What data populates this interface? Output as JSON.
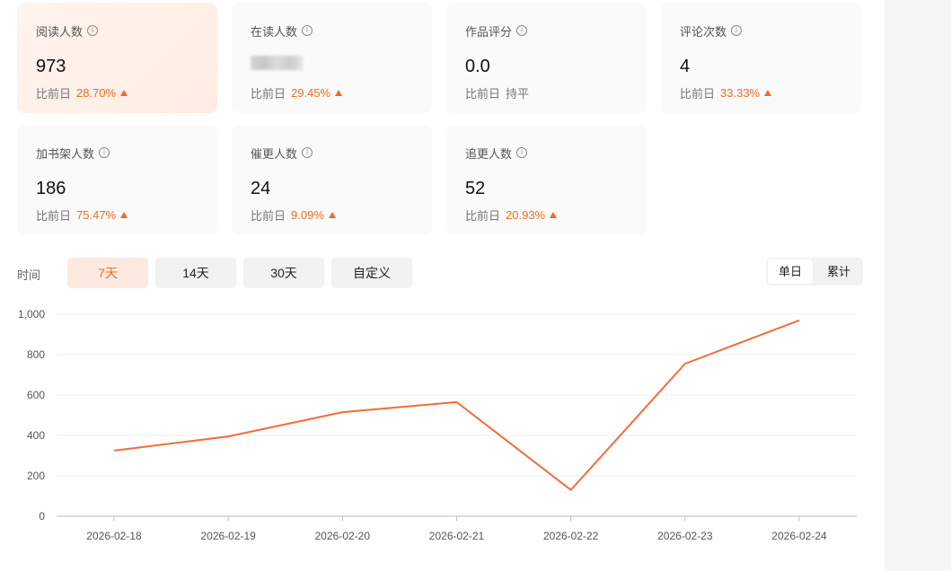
{
  "cards": [
    {
      "title": "阅读人数",
      "value": "973",
      "compare_label": "比前日",
      "compare_value": "28.70%",
      "trend": "up"
    },
    {
      "title": "在读人数",
      "value": "",
      "compare_label": "比前日",
      "compare_value": "29.45%",
      "trend": "up"
    },
    {
      "title": "作品评分",
      "value": "0.0",
      "compare_label": "比前日",
      "compare_value": "持平",
      "trend": "flat"
    },
    {
      "title": "评论次数",
      "value": "4",
      "compare_label": "比前日",
      "compare_value": "33.33%",
      "trend": "up"
    },
    {
      "title": "加书架人数",
      "value": "186",
      "compare_label": "比前日",
      "compare_value": "75.47%",
      "trend": "up"
    },
    {
      "title": "催更人数",
      "value": "24",
      "compare_label": "比前日",
      "compare_value": "9.09%",
      "trend": "up"
    },
    {
      "title": "追更人数",
      "value": "52",
      "compare_label": "比前日",
      "compare_value": "20.93%",
      "trend": "up"
    }
  ],
  "time_label": "时间",
  "ranges": [
    "7天",
    "14天",
    "30天",
    "自定义"
  ],
  "active_range": "7天",
  "modes": [
    "单日",
    "累计"
  ],
  "active_mode": "单日",
  "icons": {
    "info": "info-circle-icon",
    "trend_up": "triangle-up-icon"
  },
  "colors": {
    "accent": "#f06b1f",
    "line": "#f36b3a"
  },
  "chart_data": {
    "type": "line",
    "categories": [
      "2026-02-18",
      "2026-02-19",
      "2026-02-20",
      "2026-02-21",
      "2026-02-22",
      "2026-02-23",
      "2026-02-24"
    ],
    "series": [
      {
        "values": [
          325,
          395,
          515,
          565,
          130,
          755,
          970
        ]
      }
    ],
    "ylim": [
      0,
      1000
    ],
    "yticks": [
      0,
      200,
      400,
      600,
      800,
      1000
    ],
    "ytick_labels": [
      "0",
      "200",
      "400",
      "600",
      "800",
      "1,000"
    ],
    "grid": true
  }
}
